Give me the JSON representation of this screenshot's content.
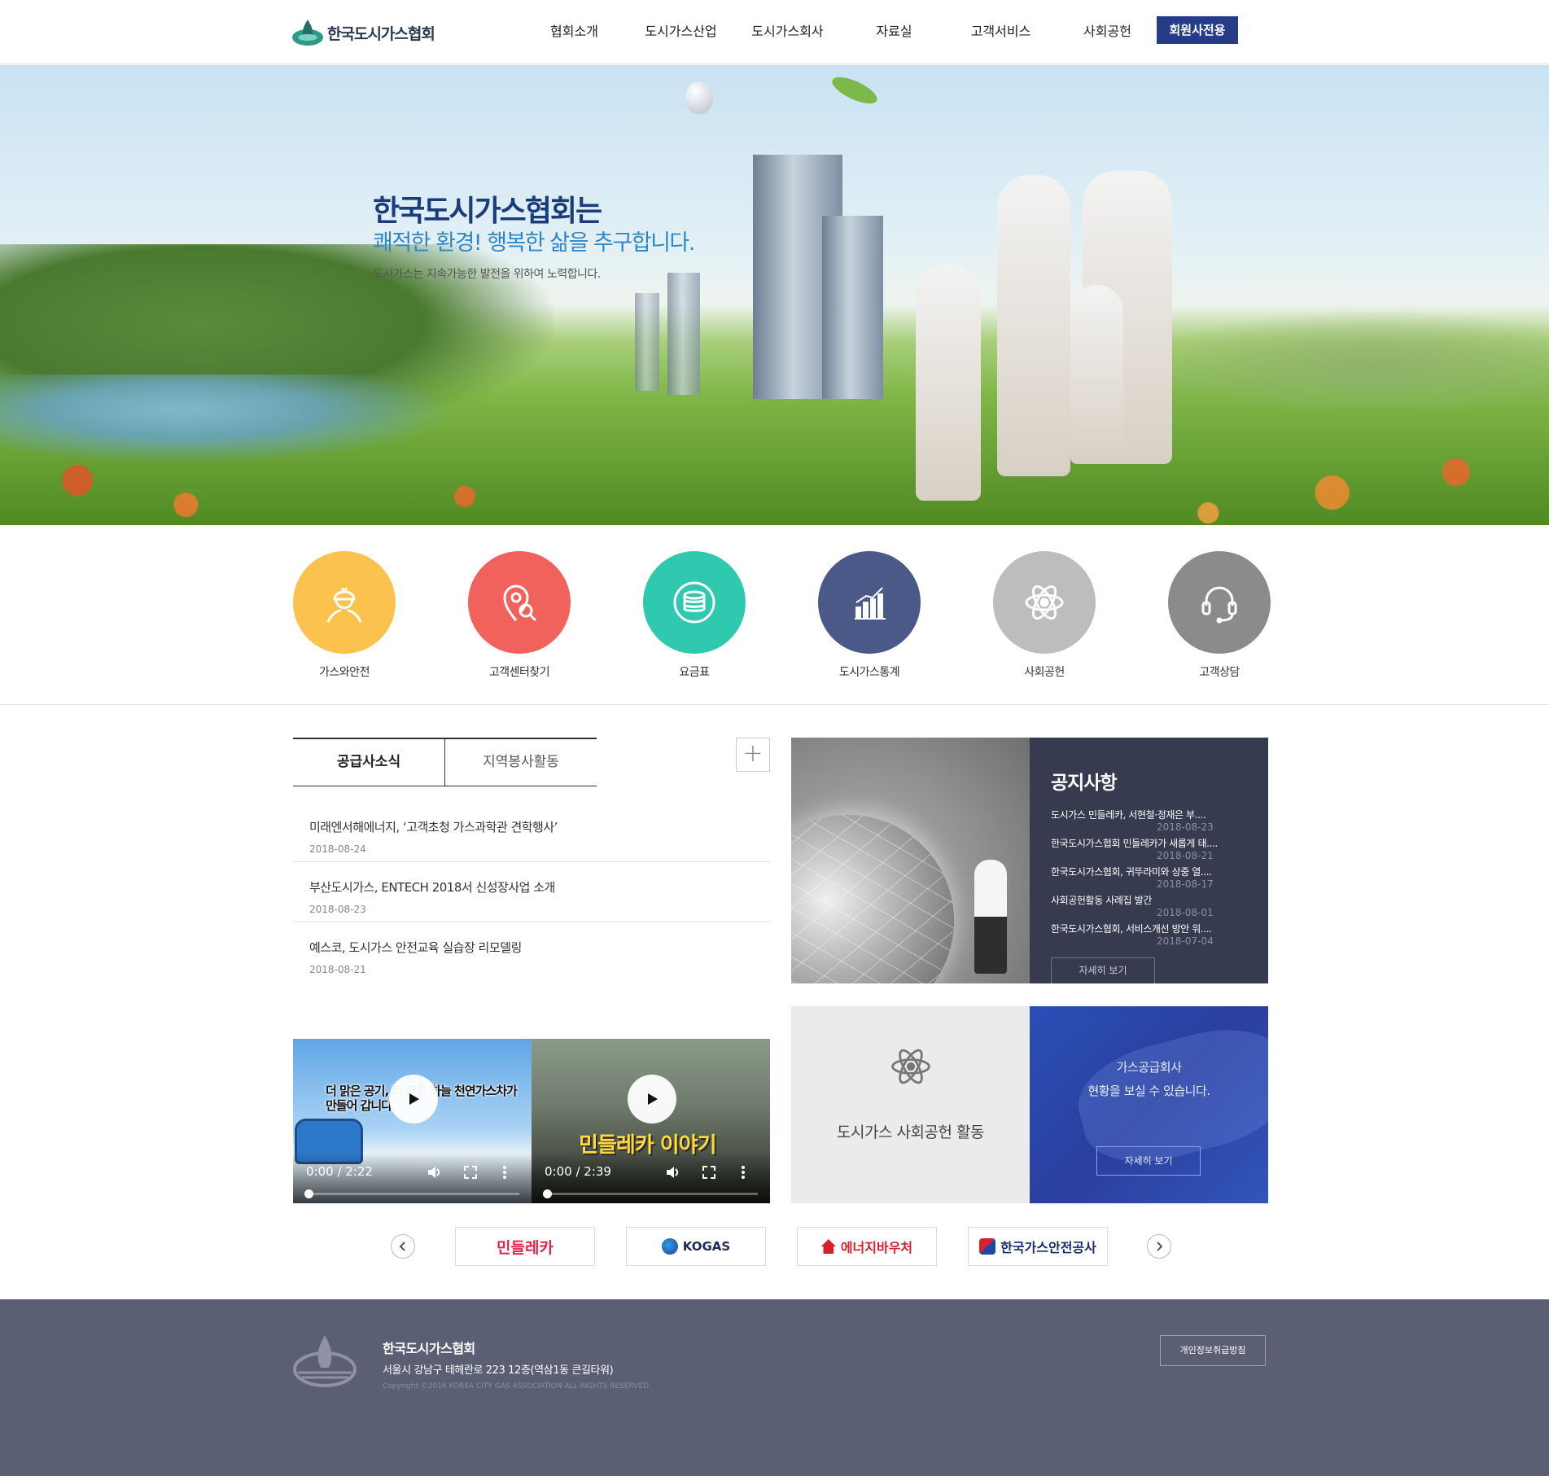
{
  "header": {
    "logo_text": "한국도시가스협회",
    "nav": [
      "협회소개",
      "도시가스산업",
      "도시가스회사",
      "자료실",
      "고객서비스",
      "사회공헌"
    ],
    "member_label": "회원사전용"
  },
  "hero": {
    "title": "한국도시가스협회는",
    "subtitle": "쾌적한 환경! 행복한 삶을 추구합니다.",
    "desc": "도시가스는 지속가능한 발전을 위하여 노력합니다."
  },
  "quick_links": [
    {
      "label": "가스와안전",
      "color": "#fbc24e",
      "icon": "worker-icon"
    },
    {
      "label": "고객센터찾기",
      "color": "#f2625d",
      "icon": "location-search-icon"
    },
    {
      "label": "요금표",
      "color": "#2fc9b0",
      "icon": "coin-stack-icon"
    },
    {
      "label": "도시가스통계",
      "color": "#4a5988",
      "icon": "chart-icon"
    },
    {
      "label": "사회공헌",
      "color": "#bdbdbd",
      "icon": "atom-icon"
    },
    {
      "label": "고객상담",
      "color": "#8b8b8b",
      "icon": "headset-icon"
    }
  ],
  "news": {
    "tabs": [
      "공급사소식",
      "지역봉사활동"
    ],
    "more_label": "+",
    "items": [
      {
        "title": "미래엔서해에너지, ‘고객초청 가스과학관 견학행사’",
        "date": "2018-08-24"
      },
      {
        "title": "부산도시가스, ENTECH 2018서 신성장사업 소개",
        "date": "2018-08-23"
      },
      {
        "title": "예스코, 도시가스 안전교육 실습장 리모델링",
        "date": "2018-08-21"
      }
    ]
  },
  "notice": {
    "title": "공지사항",
    "items": [
      {
        "title": "도시가스 민들레카, 서현철·정재은 부....",
        "date": "2018-08-23"
      },
      {
        "title": "한국도시가스협회 민들레카가 새롭게 태....",
        "date": "2018-08-21"
      },
      {
        "title": "한국도시가스협회, 귀뚜라미와 상중 열....",
        "date": "2018-08-17"
      },
      {
        "title": "사회공헌활동 사례집 발간",
        "date": "2018-08-01"
      },
      {
        "title": "한국도시가스협회, 서비스개선 방안 워....",
        "date": "2018-07-04"
      }
    ],
    "more_label": "자세히 보기"
  },
  "videos": [
    {
      "caption": "더 맑은 공기, 더 푸른 하늘 천연가스차가 만들어 갑니다.",
      "time": "0:00 / 2:22"
    },
    {
      "caption": "민들레카 이야기",
      "time": "0:00 / 2:39"
    }
  ],
  "csr": {
    "label": "도시가스 사회공헌 활동"
  },
  "company": {
    "line1": "가스공급회사",
    "line2": "현황을 보실 수 있습니다.",
    "more_label": "자세히 보기"
  },
  "partners": [
    "민들레카",
    "KOGAS",
    "에너지바우처",
    "한국가스안전공사"
  ],
  "footer": {
    "org": "한국도시가스협회",
    "address": "서울시 강남구 테헤란로 223 12층(역삼1동 큰길타워)",
    "copyright": "Copyright ©2016 KOREA CITY GAS ASSOCIATION ALL RIGHTS RESERVED",
    "privacy": "개인정보취급방침"
  }
}
